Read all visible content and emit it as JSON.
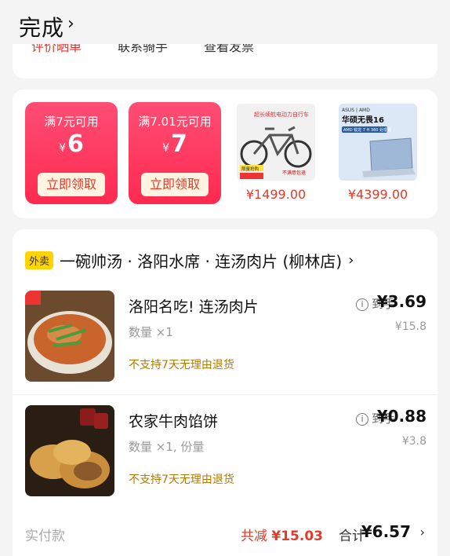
{
  "header": {
    "title": "完成",
    "chevron": "›"
  },
  "tabs": [
    "评价晒单",
    "联系骑手",
    "查看发票"
  ],
  "coupons": [
    {
      "condition": "满7元可用",
      "currency": "¥",
      "amount": "6",
      "button": "立即领取"
    },
    {
      "condition": "满7.01元可用",
      "currency": "¥",
      "amount": "7",
      "button": "立即领取"
    }
  ],
  "products": [
    {
      "price": "¥1499.00",
      "banner": "超长续航电动力自行车",
      "tag1": "限量抢购",
      "tag2": "不满意包退"
    },
    {
      "price": "¥4399.00",
      "brand": "ASUS | AMD",
      "model": "华硕无畏16",
      "sub": "AMD 锐龙 7 H 360 处理器"
    }
  ],
  "shop": {
    "badge": "外卖",
    "name": "一碗帅汤 · 洛阳水席 · 连汤肉片 (柳林店)",
    "arrow": "›"
  },
  "items": [
    {
      "name": "洛阳名吃! 连汤肉片",
      "qty": "数量 ×1",
      "refund": "不支持7天无理由退货",
      "pay_label": "到手",
      "pay": "¥3.69",
      "orig": "¥15.8"
    },
    {
      "name": "农家牛肉馅饼",
      "qty": "数量 ×1, 份量",
      "refund": "不支持7天无理由退货",
      "pay_label": "到手",
      "pay": "¥0.88",
      "orig": "¥3.8"
    }
  ],
  "footer": {
    "label": "实付款",
    "discount_label": "共减",
    "discount": "¥15.03",
    "total_label": "合计",
    "total": "¥6.57",
    "arrow": "›"
  },
  "icons": {
    "info": "i-icon",
    "chevron": "chevron-right-icon"
  }
}
